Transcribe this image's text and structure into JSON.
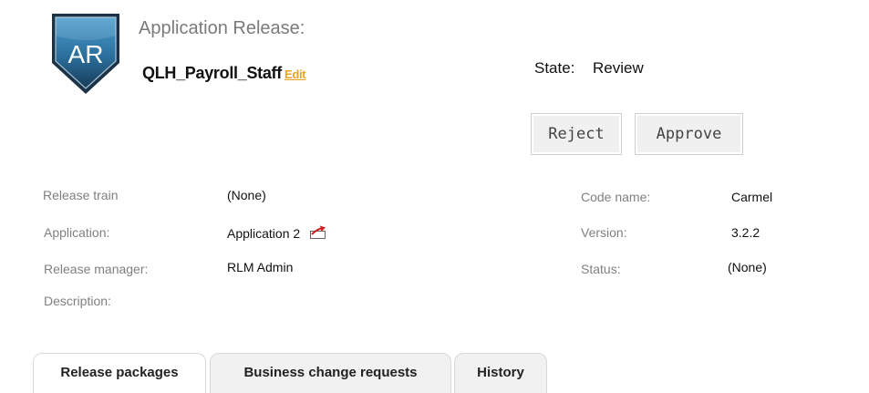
{
  "header": {
    "logo_text": "AR",
    "title_label": "Application Release:",
    "release_name": "QLH_Payroll_Staff",
    "edit_link": "Edit",
    "state_label": "State:",
    "state_value": "Review"
  },
  "actions": {
    "reject": "Reject",
    "approve": "Approve"
  },
  "details": {
    "release_train_label": "Release train",
    "release_train_value": "(None)",
    "application_label": "Application:",
    "application_value": "Application 2",
    "release_manager_label": "Release manager:",
    "release_manager_value": "RLM Admin",
    "description_label": "Description:",
    "code_name_label": "Code name:",
    "code_name_value": "Carmel",
    "version_label": "Version:",
    "version_value": "3.2.2",
    "status_label": "Status:",
    "status_value": "(None)"
  },
  "tabs": [
    {
      "label": "Release packages",
      "active": true
    },
    {
      "label": "Business change requests",
      "active": false
    },
    {
      "label": "History",
      "active": false
    }
  ],
  "colors": {
    "edit_link": "#e8a320",
    "logo_dark": "#1a3d57",
    "logo_light": "#3d8fbf",
    "external_link_icon": "#cc2222"
  },
  "icons": {
    "logo": "shield-logo",
    "application_link": "external-link-icon"
  }
}
